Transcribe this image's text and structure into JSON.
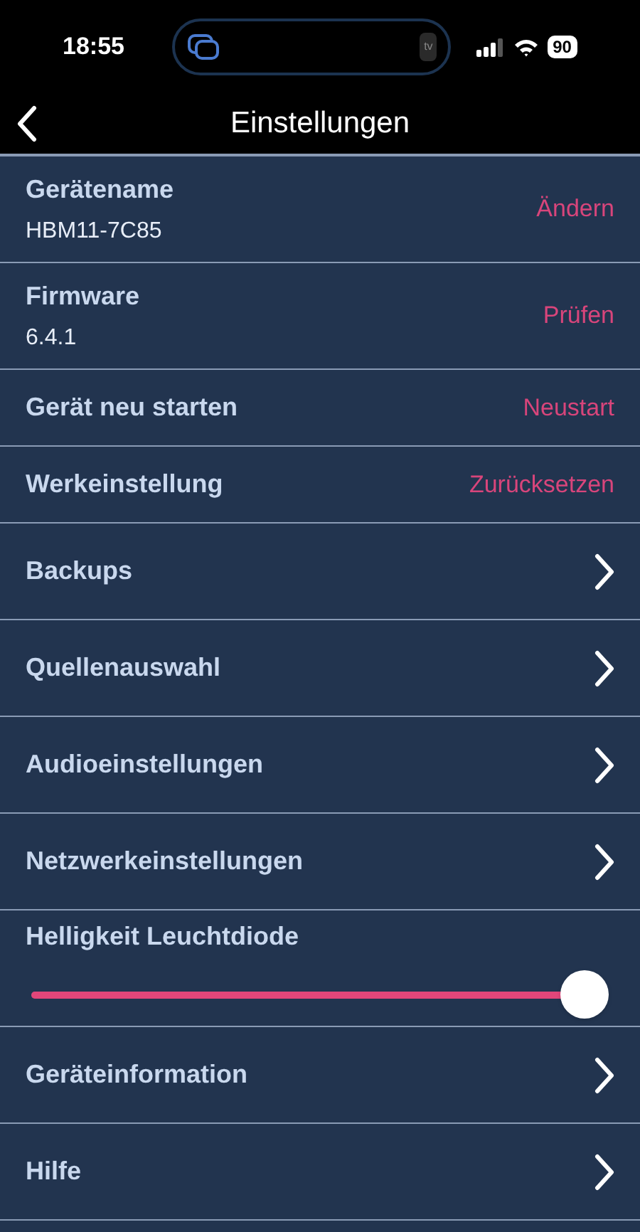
{
  "status_bar": {
    "time": "18:55",
    "island_app": "tv",
    "battery": "90"
  },
  "nav": {
    "title": "Einstellungen"
  },
  "rows": [
    {
      "kind": "action",
      "label": "Gerätename",
      "value": "HBM11-7C85",
      "action": "Ändern"
    },
    {
      "kind": "action",
      "label": "Firmware",
      "value": "6.4.1",
      "action": "Prüfen"
    },
    {
      "kind": "action",
      "label": "Gerät neu starten",
      "action": "Neustart"
    },
    {
      "kind": "action",
      "label": "Werkeinstellung",
      "action": "Zurücksetzen"
    },
    {
      "kind": "link",
      "label": "Backups"
    },
    {
      "kind": "link",
      "label": "Quellenauswahl"
    },
    {
      "kind": "link",
      "label": "Audioeinstellungen"
    },
    {
      "kind": "link",
      "label": "Netzwerkeinstellungen"
    },
    {
      "kind": "slider",
      "label": "Helligkeit Leuchtdiode",
      "level": 1
    },
    {
      "kind": "link",
      "label": "Geräteinformation"
    },
    {
      "kind": "link",
      "label": "Hilfe"
    }
  ]
}
